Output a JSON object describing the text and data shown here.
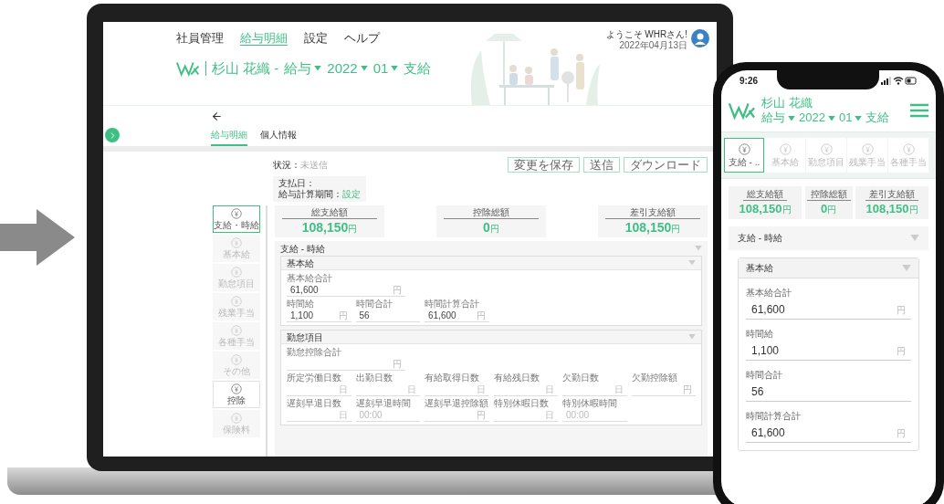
{
  "laptop": {
    "nav": [
      {
        "label": "社員管理",
        "selected": false
      },
      {
        "label": "給与明細",
        "selected": true
      },
      {
        "label": "設定",
        "selected": false
      },
      {
        "label": "ヘルプ",
        "selected": false
      }
    ],
    "title": {
      "name": "杉山 花織 -",
      "selects": [
        "給与",
        "2022",
        "01"
      ],
      "suffix": "支給"
    },
    "user": {
      "greeting": "ようこそ WHRさん!",
      "date": "2022年04月13日"
    },
    "tabs": [
      {
        "label": "給与明細",
        "selected": true
      },
      {
        "label": "個人情報",
        "selected": false
      }
    ],
    "status": {
      "label": "状況：",
      "value": "未送信"
    },
    "actions": [
      "変更を保存",
      "送信",
      "ダウンロード"
    ],
    "pay_info": {
      "pay_date_label": "支払日：",
      "period_label": "給与計算期間：",
      "period_link": "設定"
    },
    "sidebar": [
      {
        "label": "支給・時給",
        "kind": "item",
        "selected": true
      },
      {
        "label": "基本給",
        "kind": "item",
        "selected": false
      },
      {
        "label": "勤怠項目",
        "kind": "item",
        "selected": false
      },
      {
        "label": "残業手当",
        "kind": "item",
        "selected": false
      },
      {
        "label": "各種手当",
        "kind": "item",
        "selected": false
      },
      {
        "label": "その他",
        "kind": "item",
        "selected": false
      },
      {
        "label": "控除",
        "kind": "group",
        "selected": false
      },
      {
        "label": "保険料",
        "kind": "item",
        "selected": false
      }
    ],
    "summary": [
      {
        "label": "総支給額",
        "value": "108,150",
        "unit": "円"
      },
      {
        "label": "控除総額",
        "value": "0",
        "unit": "円"
      },
      {
        "label": "差引支給額",
        "value": "108,150",
        "unit": "円"
      }
    ],
    "section": {
      "title": "支給 - 時給"
    },
    "groups": [
      {
        "title": "基本給",
        "rows": [
          [
            {
              "label": "基本給合計",
              "value": "61,600",
              "unit": "円"
            }
          ],
          [
            {
              "label": "時間給",
              "value": "1,100",
              "unit": "円"
            },
            {
              "label": "時間合計",
              "value": "56"
            },
            {
              "label": "時間計算合計",
              "value": "61,600",
              "unit": "円"
            }
          ]
        ]
      },
      {
        "title": "勤怠項目",
        "rows": [
          [
            {
              "label": "勤怠控除合計",
              "unit": "円"
            }
          ],
          [
            {
              "label": "所定労働日数",
              "unit": "日"
            },
            {
              "label": "出勤日数",
              "unit": "日"
            },
            {
              "label": "有給取得日数",
              "unit": "日"
            },
            {
              "label": "有給残日数",
              "unit": "日"
            },
            {
              "label": "欠勤日数",
              "unit": "日"
            },
            {
              "label": "欠勤控除額",
              "unit": "円"
            }
          ],
          [
            {
              "label": "遅刻早退日数",
              "unit": "日"
            },
            {
              "label": "遅刻早退時間",
              "placeholder": "00:00"
            },
            {
              "label": "遅刻早退控除額",
              "unit": "円"
            },
            {
              "label": "特別休暇日数",
              "unit": "日"
            },
            {
              "label": "特別休暇時間",
              "placeholder": "00:00"
            }
          ]
        ]
      }
    ]
  },
  "phone": {
    "time": "9:26",
    "title": {
      "name": "杉山 花織",
      "selects": [
        "給与",
        "2022",
        "01"
      ],
      "suffix": "支給"
    },
    "tabs": [
      {
        "label": "支給 - ..",
        "selected": true
      },
      {
        "label": "基本給",
        "selected": false
      },
      {
        "label": "勤怠項目",
        "selected": false
      },
      {
        "label": "残業手当",
        "selected": false
      },
      {
        "label": "各種手当",
        "selected": false
      }
    ],
    "summary": [
      {
        "label": "総支給額",
        "value": "108,150",
        "unit": "円"
      },
      {
        "label": "控除総額",
        "value": "0",
        "unit": "円"
      },
      {
        "label": "差引支給額",
        "value": "108,150",
        "unit": "円"
      }
    ],
    "section": {
      "title": "支給 - 時給"
    },
    "group": {
      "title": "基本給",
      "fields": [
        {
          "label": "基本給合計",
          "value": "61,600",
          "unit": "円"
        },
        {
          "label": "時間給",
          "value": "1,100",
          "unit": "円"
        },
        {
          "label": "時間合計",
          "value": "56"
        },
        {
          "label": "時間計算合計",
          "value": "61,600",
          "unit": "円"
        }
      ]
    }
  }
}
